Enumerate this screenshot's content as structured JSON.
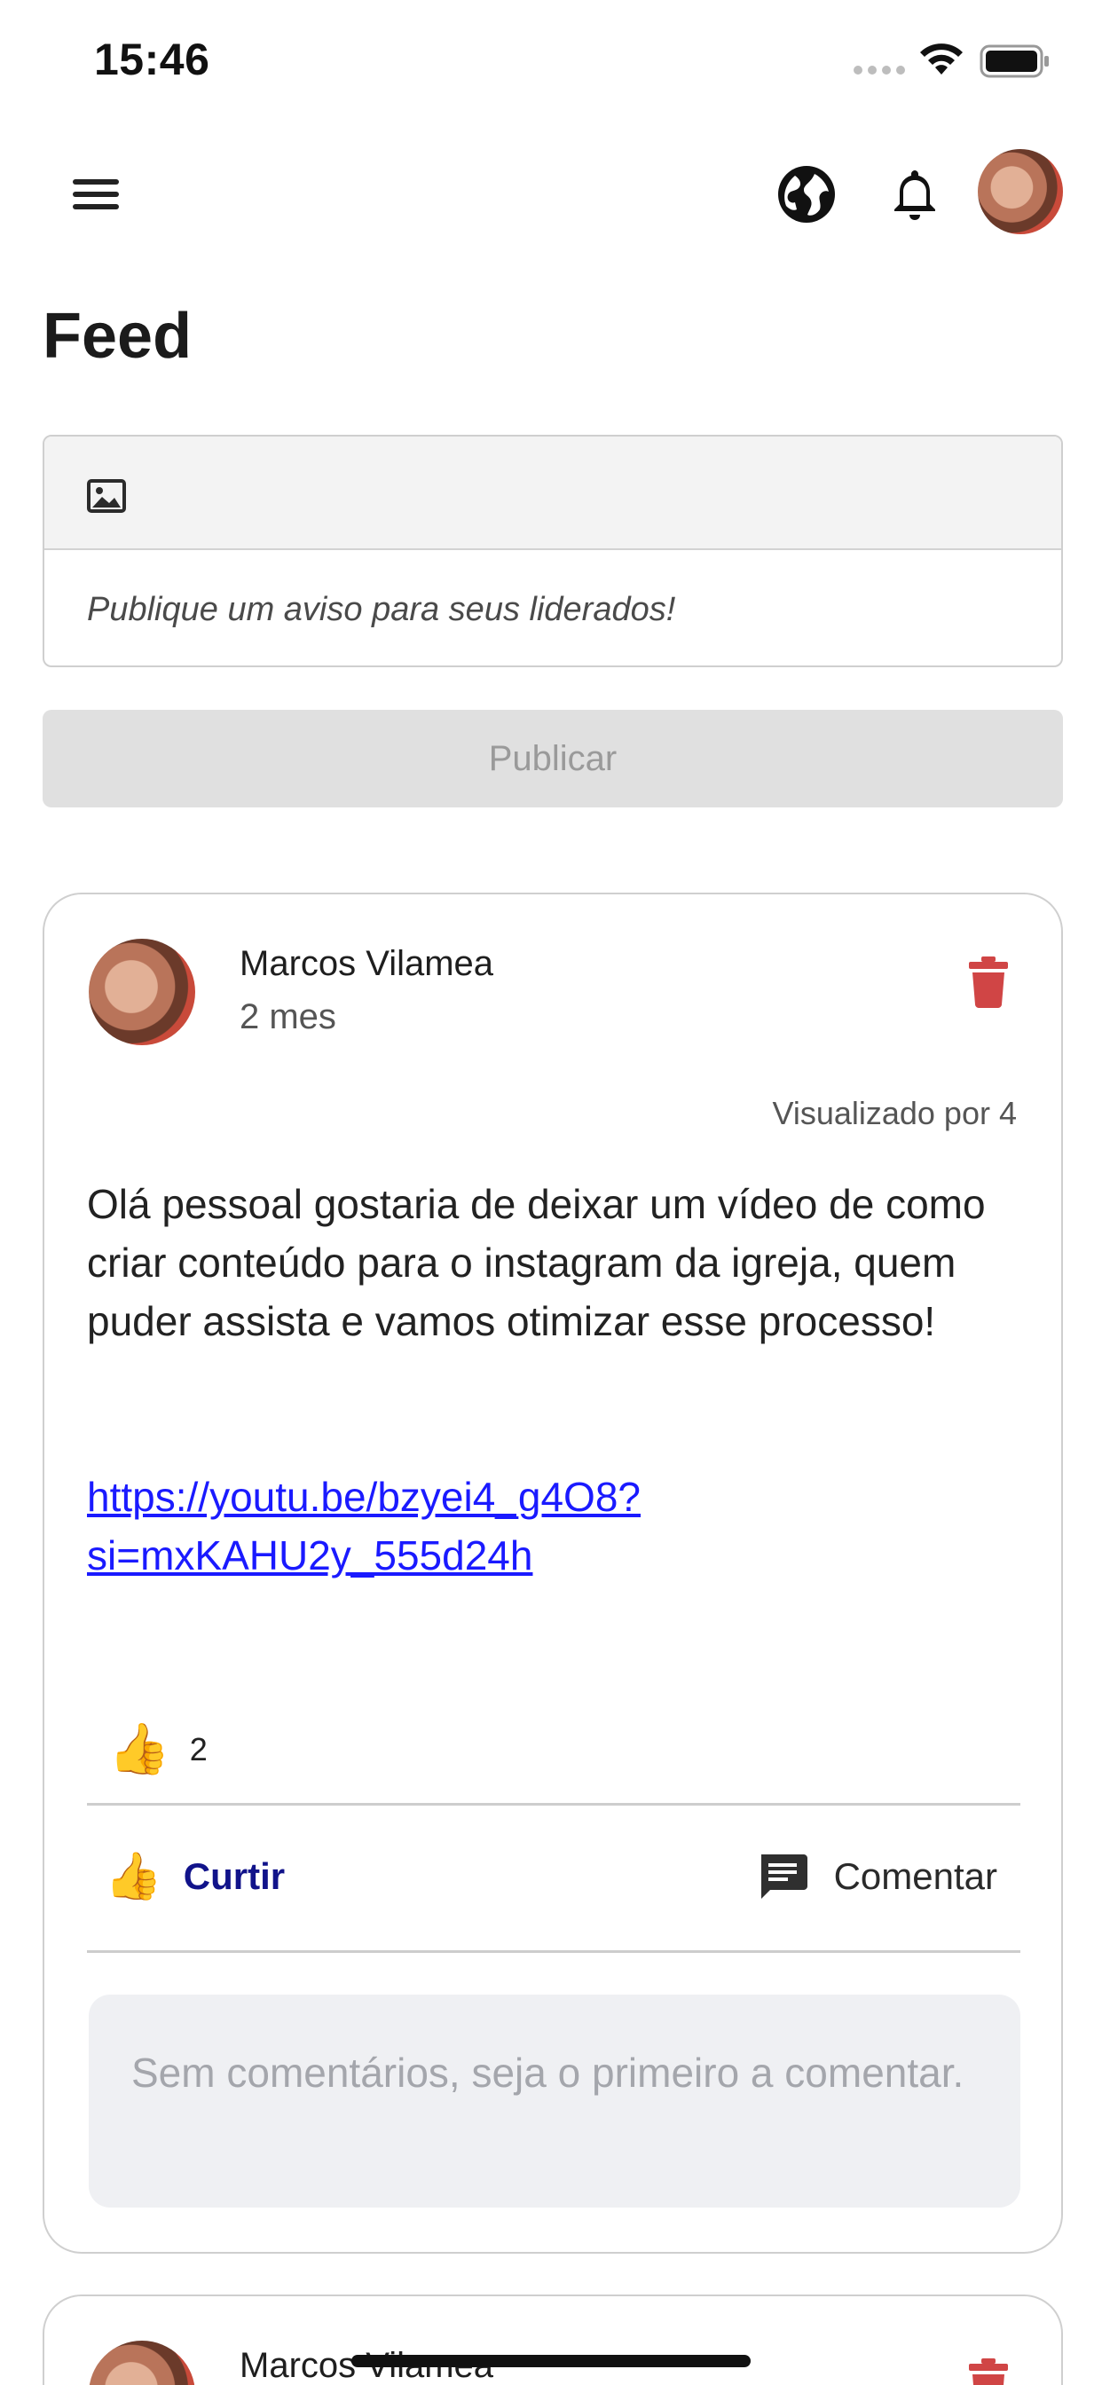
{
  "status_bar": {
    "time": "15:46"
  },
  "header": {
    "menu_icon": "hamburger-menu-icon",
    "globe_icon": "globe-icon",
    "bell_icon": "bell-icon"
  },
  "page": {
    "title": "Feed"
  },
  "composer": {
    "image_icon": "image-icon",
    "placeholder": "Publique um aviso para seus liderados!",
    "value": ""
  },
  "publish_button": {
    "label": "Publicar"
  },
  "posts": [
    {
      "author": "Marcos Vilamea",
      "time": "2 mes",
      "views": "Visualizado por 4",
      "text": "Olá pessoal gostaria de deixar um vídeo de como criar conteúdo para o instagram da igreja, quem puder assista e vamos otimizar esse processo!",
      "link": "https://youtu.be/bzyei4_g4O8?si=mxKAHU2y_555d24h",
      "reaction_emoji": "👍",
      "reaction_count": "2",
      "like_emoji": "👍",
      "like_label": "Curtir",
      "comment_label": "Comentar",
      "comments_empty": "Sem comentários, seja o primeiro a comentar."
    },
    {
      "author": "Marcos Vilamea"
    }
  ],
  "colors": {
    "delete": "#d04545",
    "like_text": "#11138a",
    "link": "#1a1aff",
    "publish_disabled_bg": "#e0e0e0"
  }
}
